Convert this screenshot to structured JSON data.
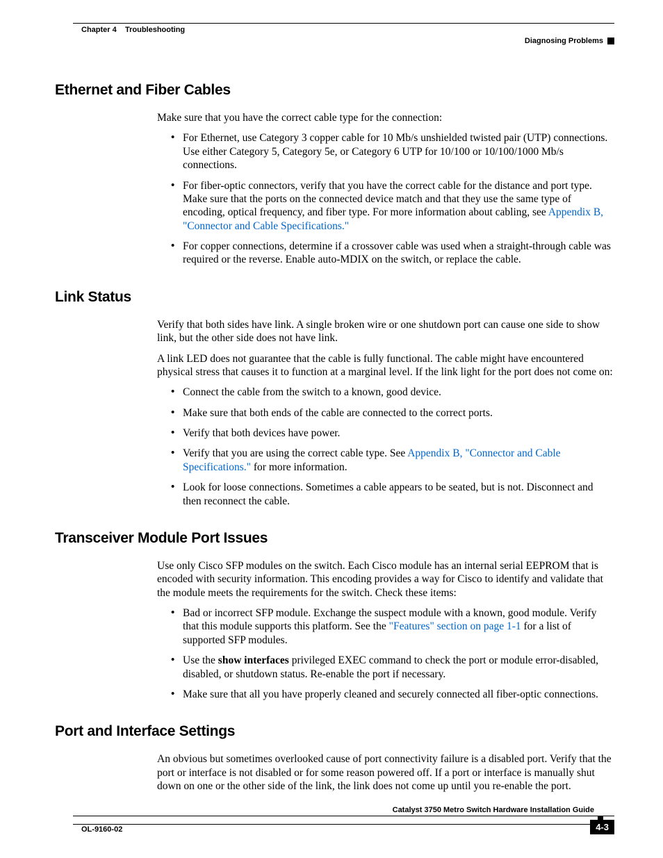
{
  "header": {
    "chapter": "Chapter 4",
    "title": "Troubleshooting",
    "section": "Diagnosing Problems"
  },
  "s1": {
    "heading": "Ethernet and Fiber Cables",
    "intro": "Make sure that you have the correct cable type for the connection:",
    "b1": "For Ethernet, use Category 3 copper cable for 10 Mb/s unshielded twisted pair (UTP) connections. Use either Category 5, Category 5e, or Category 6 UTP for 10/100 or 10/100/1000 Mb/s connections.",
    "b2a": "For fiber-optic connectors, verify that you have the correct cable for the distance and port type. Make sure that the ports on the connected device match and that they use the same type of encoding, optical frequency, and fiber type. For more information about cabling, see ",
    "b2link": "Appendix B, \"Connector and Cable Specifications.\"",
    "b3": "For copper connections, determine if a crossover cable was used when a straight-through cable was required or the reverse. Enable auto-MDIX on the switch, or replace the cable."
  },
  "s2": {
    "heading": "Link Status",
    "p1": "Verify that both sides have link. A single broken wire or one shutdown port can cause one side to show link, but the other side does not have link.",
    "p2": "A link LED does not guarantee that the cable is fully functional. The cable might have encountered physical stress that causes it to function at a marginal level. If the link light for the port does not come on:",
    "b1": "Connect the cable from the switch to a known, good device.",
    "b2": "Make sure that both ends of the cable are connected to the correct ports.",
    "b3": "Verify that both devices have power.",
    "b4a": "Verify that you are using the correct cable type. See ",
    "b4link": "Appendix B, \"Connector and Cable Specifications.\"",
    "b4b": " for more information.",
    "b5": "Look for loose connections. Sometimes a cable appears to be seated, but is not. Disconnect and then reconnect the cable."
  },
  "s3": {
    "heading": "Transceiver Module Port Issues",
    "p1": "Use only Cisco SFP modules on the switch. Each Cisco module has an internal serial EEPROM that is encoded with security information. This encoding provides a way for Cisco to identify and validate that the module meets the requirements for the switch. Check these items:",
    "b1a": "Bad or incorrect SFP module. Exchange the suspect module with a known, good module. Verify that this module supports this platform. See the ",
    "b1link": "\"Features\" section on page 1-1",
    "b1b": " for a list of supported SFP modules.",
    "b2a": "Use the ",
    "b2bold": "show interfaces",
    "b2b": " privileged EXEC command to check the port or module error-disabled, disabled, or shutdown status. Re-enable the port if necessary.",
    "b3": "Make sure that all you have properly cleaned and securely connected all fiber-optic connections."
  },
  "s4": {
    "heading": "Port and Interface Settings",
    "p1": "An obvious but sometimes overlooked cause of port connectivity failure is a disabled port. Verify that the port or interface is not disabled or for some reason powered off. If a port or interface is manually shut down on one or the other side of the link, the link does not come up until you re-enable the port."
  },
  "footer": {
    "guide": "Catalyst 3750 Metro Switch Hardware Installation Guide",
    "docnum": "OL-9160-02",
    "pagenum": "4-3"
  }
}
